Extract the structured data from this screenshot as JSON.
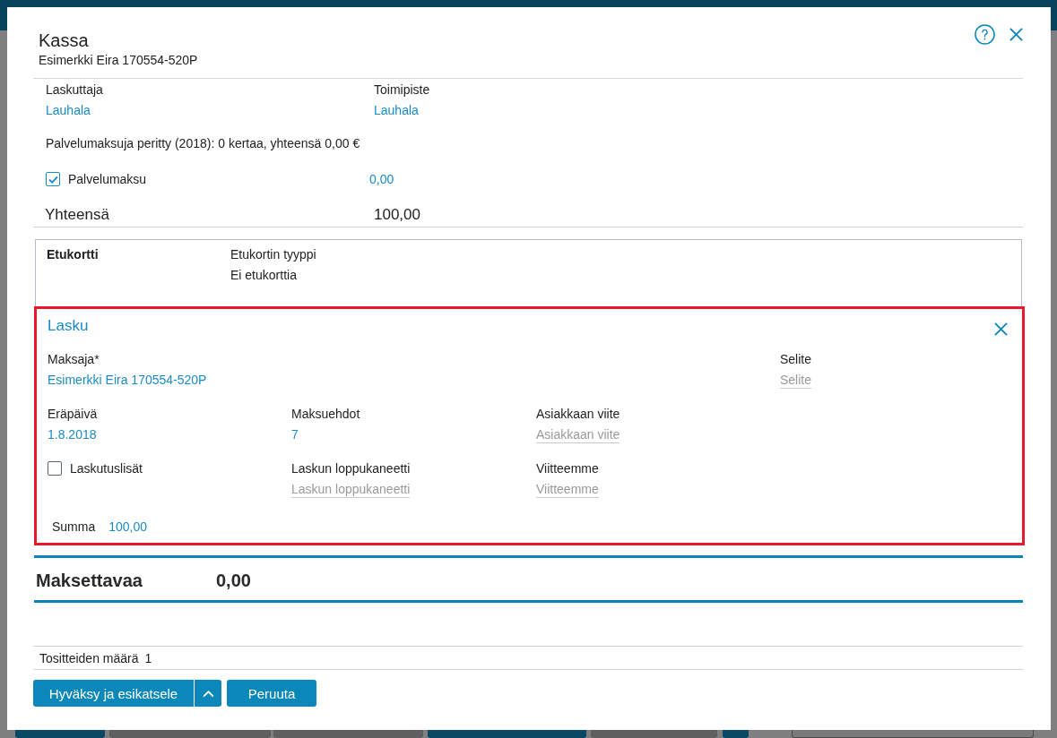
{
  "dialog": {
    "title": "Kassa",
    "subtitle": "Esimerkki Eira 170554-520P"
  },
  "header_fields": [
    {
      "label": "Laskuttaja",
      "value": "Lauhala"
    },
    {
      "label": "Toimipiste",
      "value": "Lauhala"
    }
  ],
  "service_fee_note": "Palvelumaksuja peritty (2018): 0 kertaa, yhteensä 0,00 €",
  "service_fee": {
    "label": "Palvelumaksu",
    "checked": true,
    "value": "0,00"
  },
  "total": {
    "label": "Yhteensä",
    "value": "100,00"
  },
  "benefit_card": {
    "title": "Etukortti",
    "field": {
      "label": "Etukortin tyyppi",
      "value": "Ei etukorttia"
    }
  },
  "invoice": {
    "title": "Lasku",
    "rows": [
      [
        {
          "kind": "value",
          "label": "Maksaja*",
          "value": "Esimerkki Eira 170554-520P"
        },
        "",
        "",
        {
          "kind": "input",
          "label": "Selite",
          "placeholder": "Selite"
        }
      ],
      [
        {
          "kind": "value",
          "label": "Eräpäivä",
          "value": "1.8.2018"
        },
        {
          "kind": "value",
          "label": "Maksuehdot",
          "value": "7"
        },
        {
          "kind": "input",
          "label": "Asiakkaan viite",
          "placeholder": "Asiakkaan viite"
        }
      ],
      [
        {
          "kind": "checkbox",
          "label": "Laskutuslisät",
          "checked": false
        },
        {
          "kind": "input",
          "label": "Laskun loppukaneetti",
          "placeholder": "Laskun loppukaneetti"
        },
        {
          "kind": "input",
          "label": "Viitteemme",
          "placeholder": "Viitteemme"
        }
      ]
    ],
    "sum": {
      "label": "Summa",
      "value": "100,00"
    }
  },
  "amount_due": {
    "label": "Maksettavaa",
    "value": "0,00"
  },
  "voucher_count": {
    "label": "Tositteiden määrä",
    "value": "1"
  },
  "buttons": [
    {
      "kind": "text",
      "label": "Hyväksy ja esikatsele"
    },
    {
      "kind": "menu"
    },
    {
      "kind": "text",
      "label": "Peruuta"
    }
  ]
}
